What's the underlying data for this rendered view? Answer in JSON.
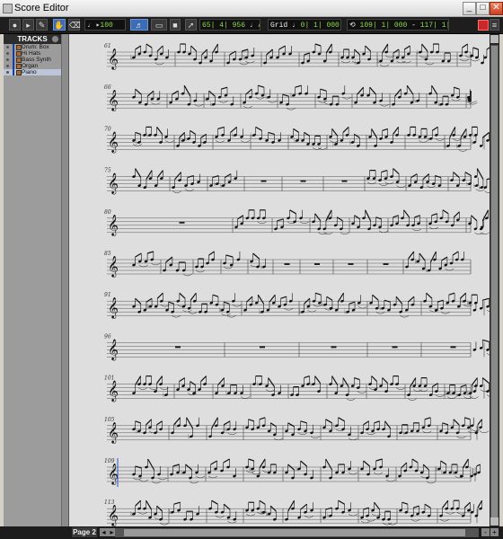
{
  "window": {
    "title": "Score Editor"
  },
  "toolbar": {
    "zoom_value": "100",
    "counter_main": "65| 4| 956",
    "note_name": "A5",
    "grid_label": "Grid",
    "grid_value": "0| 1| 000",
    "range_start": "109| 1| 000",
    "range_end": "117| 1| 000"
  },
  "tracks": {
    "header": "TRACKS",
    "items": [
      {
        "name": "Drum: Box"
      },
      {
        "name": "Hi Hats"
      },
      {
        "name": "Bass Synth"
      },
      {
        "name": "Organ"
      },
      {
        "name": "Piano"
      }
    ],
    "selected_index": 4
  },
  "score": {
    "systems": [
      {
        "measure": "61",
        "bars": [
          26,
          76,
          131,
          172,
          214,
          258,
          301,
          345,
          390,
          427
        ],
        "rests": []
      },
      {
        "measure": "66",
        "bars": [
          26,
          67,
          108,
          149,
          190,
          232,
          273,
          315,
          356,
          400
        ],
        "rests": []
      },
      {
        "measure": "70",
        "bars": [
          26,
          75,
          118,
          160,
          202,
          245,
          289,
          332,
          376,
          420
        ],
        "rests": []
      },
      {
        "measure": "75",
        "bars": [
          26,
          70,
          112,
          153,
          195,
          241,
          287,
          333,
          380,
          427
        ],
        "rests": [
          3,
          4,
          5
        ]
      },
      {
        "measure": "80",
        "bars": [
          26,
          140,
          184,
          226,
          270,
          313,
          356,
          400,
          445
        ],
        "rests": [
          0
        ]
      },
      {
        "measure": "85",
        "bars": [
          26,
          60,
          96,
          127,
          157,
          185,
          215,
          252,
          290,
          330
        ],
        "rests": [
          5,
          6,
          7,
          8
        ]
      },
      {
        "measure": "91",
        "bars": [
          26,
          150,
          214,
          290,
          350,
          420
        ],
        "rests": []
      },
      {
        "measure": "96",
        "bars": [
          26,
          131,
          214,
          290,
          350,
          420
        ],
        "rests": [
          0,
          1,
          2,
          3,
          4
        ]
      },
      {
        "measure": "101",
        "bars": [
          26,
          75,
          118,
          160,
          202,
          245,
          289,
          332,
          376,
          420
        ],
        "rests": []
      },
      {
        "measure": "105",
        "bars": [
          26,
          69,
          111,
          152,
          196,
          238,
          280,
          323,
          368,
          412
        ],
        "rests": []
      },
      {
        "measure": "109",
        "bars": [
          26,
          68,
          110,
          152,
          196,
          238,
          280,
          322,
          366,
          410
        ],
        "rests": []
      },
      {
        "measure": "113",
        "bars": [
          26,
          69,
          111,
          152,
          196,
          238,
          280,
          323,
          368,
          412
        ],
        "rests": []
      }
    ]
  },
  "status": {
    "page_label": "Page 2"
  },
  "colors": {
    "accent": "#3c6cb6",
    "lcd": "#8fd84c",
    "cursor": "#2a52c8"
  }
}
